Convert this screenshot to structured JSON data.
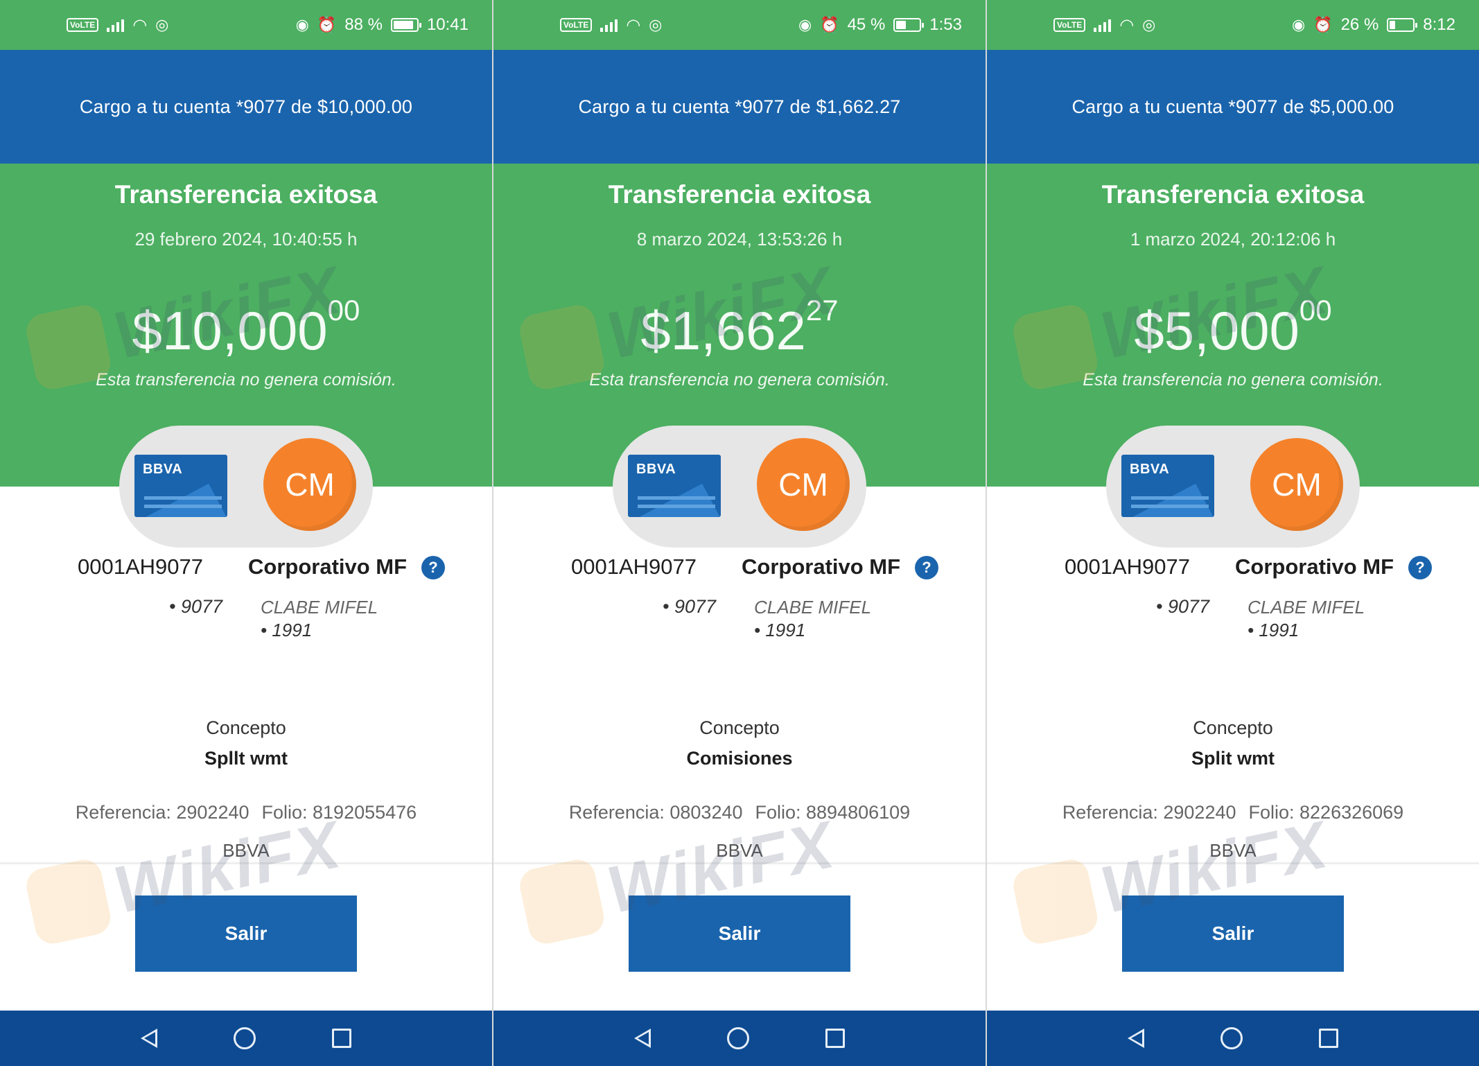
{
  "screens": [
    {
      "status": {
        "battery": "88 %",
        "battery_level": 0.88,
        "time": "10:41"
      },
      "banner": "Cargo a tu cuenta *9077 de $10,000.00",
      "title": "Transferencia exitosa",
      "datetime": "29 febrero 2024, 10:40:55 h",
      "amount_main": "$10,000",
      "amount_cents": "00",
      "no_fee": "Esta transferencia no genera comisión.",
      "bank_card_label": "BBVA",
      "avatar_initials": "CM",
      "from_account": "0001AH9077",
      "to_account": "Corporativo MF",
      "from_sub": "• 9077",
      "to_sub_line1": "CLABE MIFEL",
      "to_sub_line2": "• 1991",
      "concept_label": "Concepto",
      "concept_value": "Spllt wmt",
      "reference": "Referencia: 2902240",
      "folio": "Folio: 8192055476",
      "bank": "BBVA",
      "exit_label": "Salir"
    },
    {
      "status": {
        "battery": "45 %",
        "battery_level": 0.45,
        "time": "1:53"
      },
      "banner": "Cargo a tu cuenta *9077 de $1,662.27",
      "title": "Transferencia exitosa",
      "datetime": "8 marzo 2024, 13:53:26 h",
      "amount_main": "$1,662",
      "amount_cents": "27",
      "no_fee": "Esta transferencia no genera comisión.",
      "bank_card_label": "BBVA",
      "avatar_initials": "CM",
      "from_account": "0001AH9077",
      "to_account": "Corporativo MF",
      "from_sub": "• 9077",
      "to_sub_line1": "CLABE MIFEL",
      "to_sub_line2": "• 1991",
      "concept_label": "Concepto",
      "concept_value": "Comisiones",
      "reference": "Referencia: 0803240",
      "folio": "Folio: 8894806109",
      "bank": "BBVA",
      "exit_label": "Salir"
    },
    {
      "status": {
        "battery": "26 %",
        "battery_level": 0.26,
        "time": "8:12"
      },
      "banner": "Cargo a tu cuenta *9077 de $5,000.00",
      "title": "Transferencia exitosa",
      "datetime": "1 marzo 2024, 20:12:06 h",
      "amount_main": "$5,000",
      "amount_cents": "00",
      "no_fee": "Esta transferencia no genera comisión.",
      "bank_card_label": "BBVA",
      "avatar_initials": "CM",
      "from_account": "0001AH9077",
      "to_account": "Corporativo MF",
      "from_sub": "• 9077",
      "to_sub_line1": "CLABE MIFEL",
      "to_sub_line2": "• 1991",
      "concept_label": "Concepto",
      "concept_value": "Split wmt",
      "reference": "Referencia: 2902240",
      "folio": "Folio: 8226326069",
      "bank": "BBVA",
      "exit_label": "Salir"
    }
  ],
  "watermark_text": "WikiFX",
  "colors": {
    "status_green": "#4caf61",
    "banner_blue": "#1a64ad",
    "nav_blue": "#0d4a91",
    "avatar_orange": "#f5822a"
  }
}
